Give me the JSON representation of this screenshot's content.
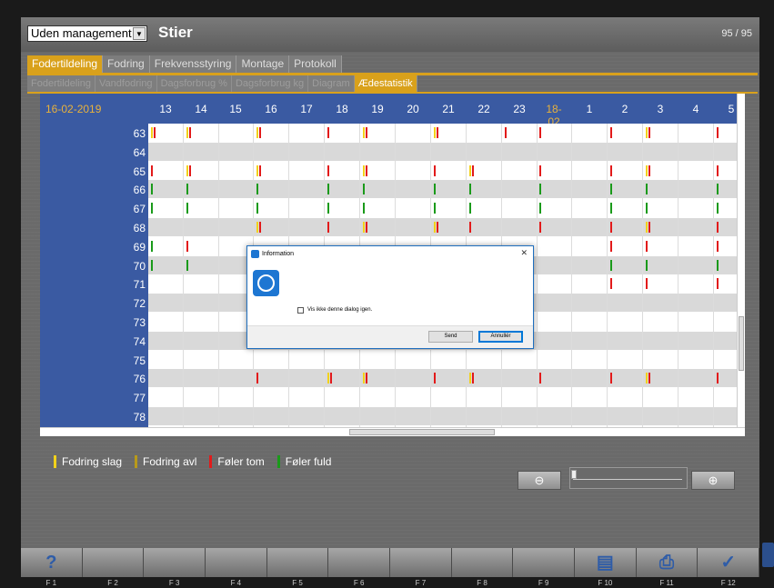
{
  "header": {
    "management_select": "Uden management",
    "title": "Stier",
    "page_count": "95 / 95"
  },
  "tabs": [
    "Fodertildeling",
    "Fodring",
    "Frekvensstyring",
    "Montage",
    "Protokoll"
  ],
  "subtabs": [
    "Fodertildeling",
    "Vandfodring",
    "Dagsforbrug %",
    "Dagsforbrug kg",
    "Diagram",
    "Ædestatistik"
  ],
  "grid": {
    "date": "16-02-2019",
    "hours": [
      "13",
      "14",
      "15",
      "16",
      "17",
      "18",
      "19",
      "20",
      "21",
      "22",
      "23",
      "18-02",
      "1",
      "2",
      "3",
      "4",
      "5"
    ],
    "rows": [
      "63",
      "64",
      "65",
      "66",
      "67",
      "68",
      "69",
      "70",
      "71",
      "72",
      "73",
      "74",
      "75",
      "76",
      "77",
      "78"
    ]
  },
  "legend": [
    {
      "label": "Fodring slag",
      "color": "#f2d21b"
    },
    {
      "label": "Fodring avl",
      "color": "#b89a1a"
    },
    {
      "label": "Føler tom",
      "color": "#e21a1a"
    },
    {
      "label": "Føler fuld",
      "color": "#1a9a1a"
    }
  ],
  "dialog": {
    "title": "Information",
    "close_glyph": "✕",
    "checkbox_label": "Vis ikke denne dialog igen.",
    "send_label": "Send",
    "cancel_label": "Annullér"
  },
  "fkeys": [
    {
      "label": "F 1",
      "icon": "?"
    },
    {
      "label": "F 2",
      "icon": ""
    },
    {
      "label": "F 3",
      "icon": ""
    },
    {
      "label": "F 4",
      "icon": ""
    },
    {
      "label": "F 5",
      "icon": ""
    },
    {
      "label": "F 6",
      "icon": ""
    },
    {
      "label": "F 7",
      "icon": ""
    },
    {
      "label": "F 8",
      "icon": ""
    },
    {
      "label": "F 9",
      "icon": ""
    },
    {
      "label": "F 10",
      "icon": "▤"
    },
    {
      "label": "F 11",
      "icon": "⎙"
    },
    {
      "label": "F 12",
      "icon": "✓"
    }
  ],
  "zoom": {
    "out_glyph": "⊖",
    "in_glyph": "⊕"
  }
}
